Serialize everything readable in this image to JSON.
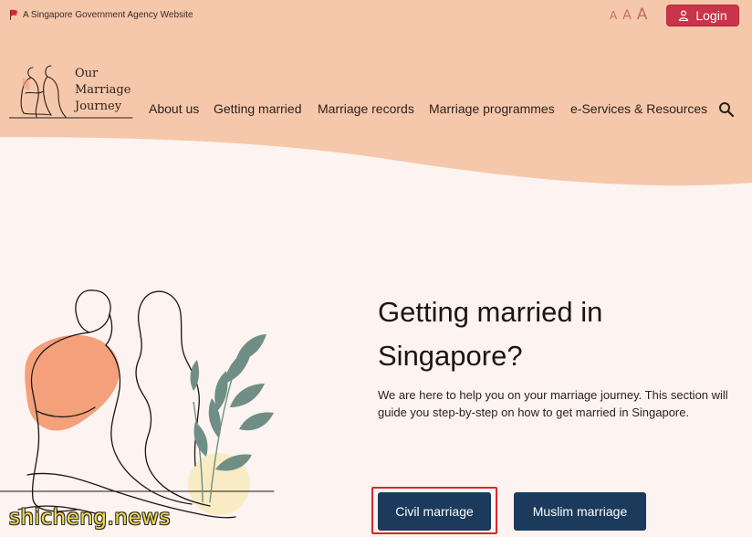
{
  "gov_banner": {
    "text": "A Singapore Government Agency Website"
  },
  "font_size_controls": [
    "A",
    "A",
    "A"
  ],
  "login": {
    "label": "Login"
  },
  "logo": {
    "lines": [
      "Our",
      "Marriage",
      "Journey"
    ]
  },
  "nav": {
    "items": [
      {
        "label": "About us"
      },
      {
        "label": "Getting married"
      },
      {
        "label": "Marriage records"
      },
      {
        "label": "Marriage programmes"
      },
      {
        "label": "e-Services & Resources"
      }
    ]
  },
  "hero": {
    "title_lines": [
      "Getting married in",
      "Singapore?"
    ],
    "description": "We are here to help you on your marriage journey. This section will guide you step-by-step on how to get married in Singapore.",
    "buttons": [
      {
        "label": "Civil marriage"
      },
      {
        "label": "Muslim marriage"
      }
    ]
  },
  "watermark": {
    "text": "shicheng.news"
  },
  "colors": {
    "header_peach": "#f6c8ab",
    "page_bg": "#fdf3f1",
    "login_red": "#c8344a",
    "button_navy": "#1c3a5c",
    "highlight_red": "#d9262b",
    "accent_orange": "#f4a07a",
    "leaf_green": "#6f8f86"
  },
  "icons": [
    "singapore-flag-icon",
    "user-icon",
    "search-icon"
  ]
}
